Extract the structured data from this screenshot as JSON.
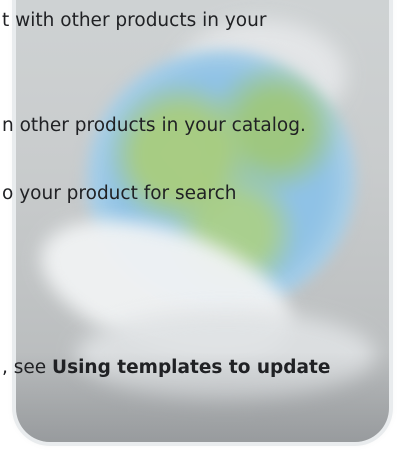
{
  "content": {
    "line1": "t with other products in your",
    "line2": "n other products in your catalog.",
    "line3": "o your product for search",
    "line4_prefix": ", see ",
    "line4_link": "Using templates to update"
  }
}
